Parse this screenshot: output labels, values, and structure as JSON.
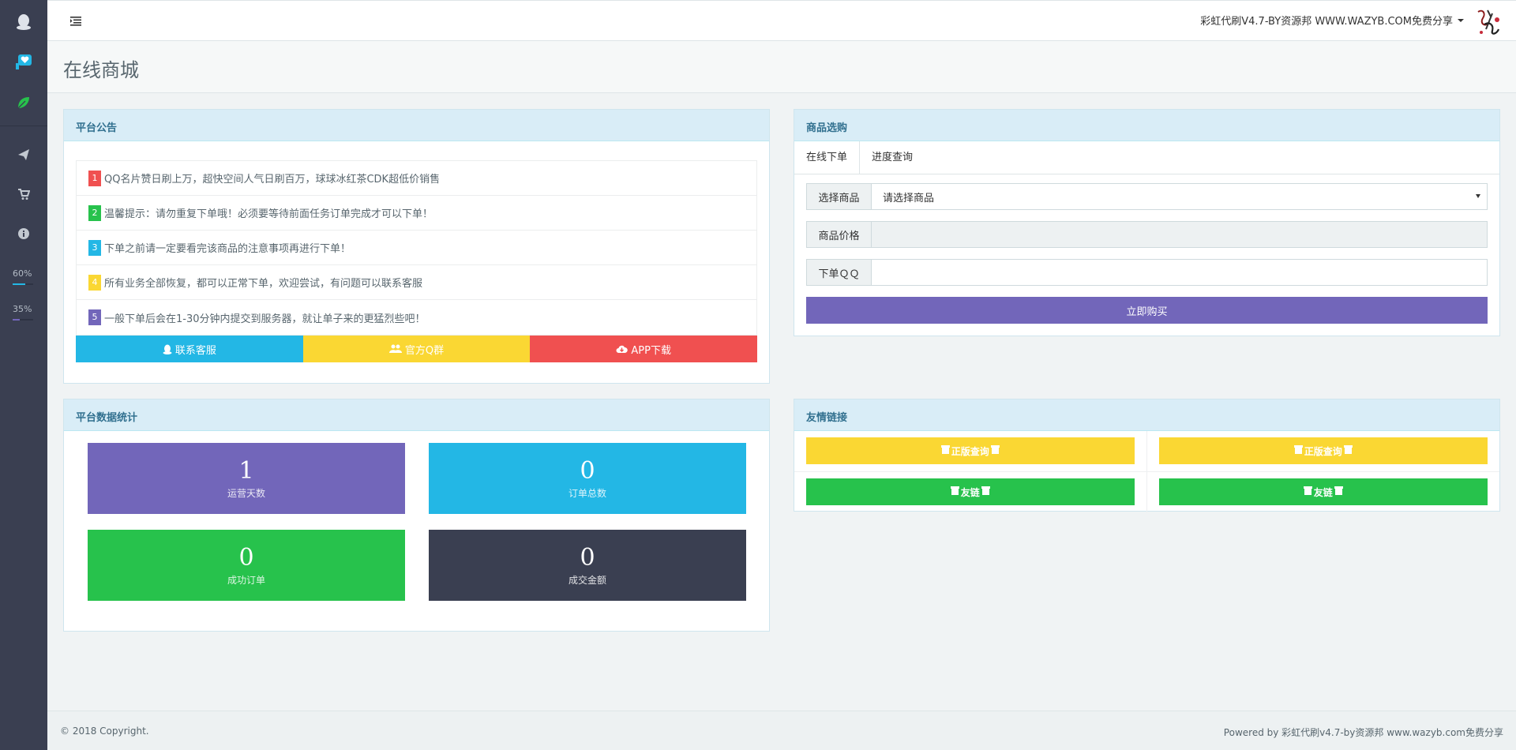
{
  "sidebar": {
    "icons": [
      "qq-penguin-icon",
      "heart-badge-icon",
      "leaf-icon",
      "send-icon",
      "cart-icon",
      "info-icon"
    ],
    "progress": [
      {
        "label": "60%",
        "value": 0.6,
        "color": "#23b7e5"
      },
      {
        "label": "35%",
        "value": 0.35,
        "color": "#7266ba"
      }
    ]
  },
  "header": {
    "site_name": "彩虹代刷V4.7-BY资源邦 WWW.WAZYB.COM免费分享"
  },
  "page": {
    "title": "在线商城"
  },
  "notice": {
    "heading": "平台公告",
    "items": [
      {
        "num": "1",
        "text": "QQ名片赞日刷上万，超快空间人气日刷百万，球球冰红茶CDK超低价销售",
        "color": "#f05050"
      },
      {
        "num": "2",
        "text": "温馨提示：请勿重复下单哦！必须要等待前面任务订单完成才可以下单！",
        "color": "#27c24c"
      },
      {
        "num": "3",
        "text": "下单之前请一定要看完该商品的注意事项再进行下单！",
        "color": "#23b7e5"
      },
      {
        "num": "4",
        "text": "所有业务全部恢复，都可以正常下单，欢迎尝试，有问题可以联系客服",
        "color": "#fad733"
      },
      {
        "num": "5",
        "text": "一般下单后会在1-30分钟内提交到服务器，就让单子来的更猛烈些吧！",
        "color": "#7266ba"
      }
    ],
    "buttons": [
      {
        "label": "联系客服",
        "color": "#23b7e5"
      },
      {
        "label": "官方Q群",
        "color": "#fad733"
      },
      {
        "label": "APP下载",
        "color": "#f05050"
      }
    ]
  },
  "shop": {
    "heading": "商品选购",
    "tabs": [
      "在线下单",
      "进度查询"
    ],
    "fields": {
      "product_label": "选择商品",
      "product_value": "请选择商品",
      "price_label": "商品价格",
      "price_value": "",
      "qq_label": "下单ＱＱ",
      "qq_value": ""
    },
    "buy_label": "立即购买"
  },
  "stats": {
    "heading": "平台数据统计",
    "items": [
      {
        "value": "1",
        "label": "运营天数",
        "color": "#7266ba"
      },
      {
        "value": "0",
        "label": "订单总数",
        "color": "#23b7e5"
      },
      {
        "value": "0",
        "label": "成功订单",
        "color": "#27c24c"
      },
      {
        "value": "0",
        "label": "成交金额",
        "color": "#3a3f51"
      }
    ]
  },
  "links": {
    "heading": "友情链接",
    "items": [
      {
        "label": "正版查询",
        "color": "#fad733"
      },
      {
        "label": "正版查询",
        "color": "#fad733"
      },
      {
        "label": "友链",
        "color": "#27c24c"
      },
      {
        "label": "友链",
        "color": "#27c24c"
      }
    ]
  },
  "footer": {
    "copyright": "© 2018 Copyright.",
    "powered": "Powered by 彩虹代刷v4.7-by资源邦 www.wazyb.com免费分享"
  }
}
